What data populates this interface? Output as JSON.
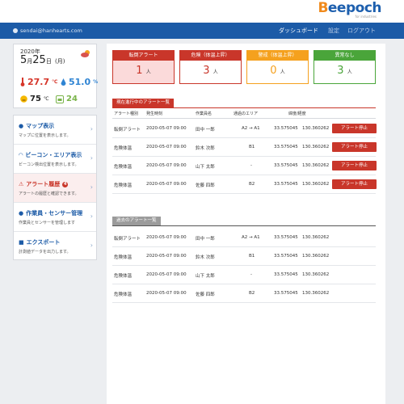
{
  "header": {
    "logo_text_b": "B",
    "logo_text_rest": "eepoch",
    "logo_sub": "for industries"
  },
  "navbar": {
    "user_email": "sendai@hanhearts.com",
    "menu": [
      "ダッシュボード",
      "設定",
      "ログアウト"
    ]
  },
  "datebox": {
    "year": "2020年",
    "month": "5",
    "day": "25",
    "weekday": "(月)",
    "temperature": "27.7",
    "temperature_unit": "℃",
    "humidity": "51.0",
    "humidity_unit": "%",
    "wbgt": "75",
    "wbgt_unit": "℃",
    "sensor_count": "24"
  },
  "sidemenu": [
    {
      "title": "マップ表示",
      "desc": "マップに位置を表示します。",
      "icon": "pin-icon"
    },
    {
      "title": "ビーコン・エリア表示",
      "desc": "ビーコン検出位置を表示します。",
      "icon": "wifi-icon"
    },
    {
      "title": "アラート履歴",
      "desc": "アラートの履歴と確認できます。",
      "icon": "warning-icon",
      "badge": "4"
    },
    {
      "title": "作業員・センサー管理",
      "desc": "作業員とセンサーを管理します",
      "icon": "users-icon"
    },
    {
      "title": "エクスポート",
      "desc": "計測値データを出力します。",
      "icon": "save-icon"
    }
  ],
  "cards": [
    {
      "label": "転倒アラート",
      "value": "1",
      "unit": "人"
    },
    {
      "label": "危険（体温上昇）",
      "value": "3",
      "unit": "人"
    },
    {
      "label": "警戒（体温上昇）",
      "value": "0",
      "unit": "人"
    },
    {
      "label": "異常なし",
      "value": "3",
      "unit": "人"
    }
  ],
  "current": {
    "title": "現在進行中のアラート一覧",
    "headers": [
      "アラート種別",
      "発生時刻",
      "作業員名",
      "通過のエリア",
      "緯度/経度"
    ],
    "stop_label": "アラート停止",
    "rows": [
      {
        "type": "転倒アラート",
        "time": "2020-05-07 09:00",
        "name": "田中 一郎",
        "area": "A2 → A1",
        "lat": "33.575045",
        "lng": "130.360262"
      },
      {
        "type": "危険体温",
        "time": "2020-05-07 09:00",
        "name": "鈴木 次郎",
        "area": "B1",
        "lat": "33.575045",
        "lng": "130.360262"
      },
      {
        "type": "危険体温",
        "time": "2020-05-07 09:00",
        "name": "山下 太郎",
        "area": "-",
        "lat": "33.575045",
        "lng": "130.360262"
      },
      {
        "type": "危険体温",
        "time": "2020-05-07 09:00",
        "name": "佐藤 四郎",
        "area": "B2",
        "lat": "33.575045",
        "lng": "130.360262"
      }
    ]
  },
  "past": {
    "title": "過去のアラート一覧",
    "rows": [
      {
        "type": "転倒アラート",
        "time": "2020-05-07 09:00",
        "name": "田中 一郎",
        "area": "A2 → A1",
        "lat": "33.575045",
        "lng": "130.360262"
      },
      {
        "type": "危険体温",
        "time": "2020-05-07 09:00",
        "name": "鈴木 次郎",
        "area": "B1",
        "lat": "33.575045",
        "lng": "130.360262"
      },
      {
        "type": "危険体温",
        "time": "2020-05-07 09:00",
        "name": "山下 太郎",
        "area": "-",
        "lat": "33.575045",
        "lng": "130.360262"
      },
      {
        "type": "危険体温",
        "time": "2020-05-07 09:00",
        "name": "佐藤 四郎",
        "area": "B2",
        "lat": "33.575045",
        "lng": "130.360262"
      }
    ]
  },
  "colors": {
    "nav": "#1c5ba7",
    "danger": "#c9362a",
    "warning": "#f5a11e",
    "ok": "#4aa53a",
    "past_tab": "#9b9b9b"
  }
}
